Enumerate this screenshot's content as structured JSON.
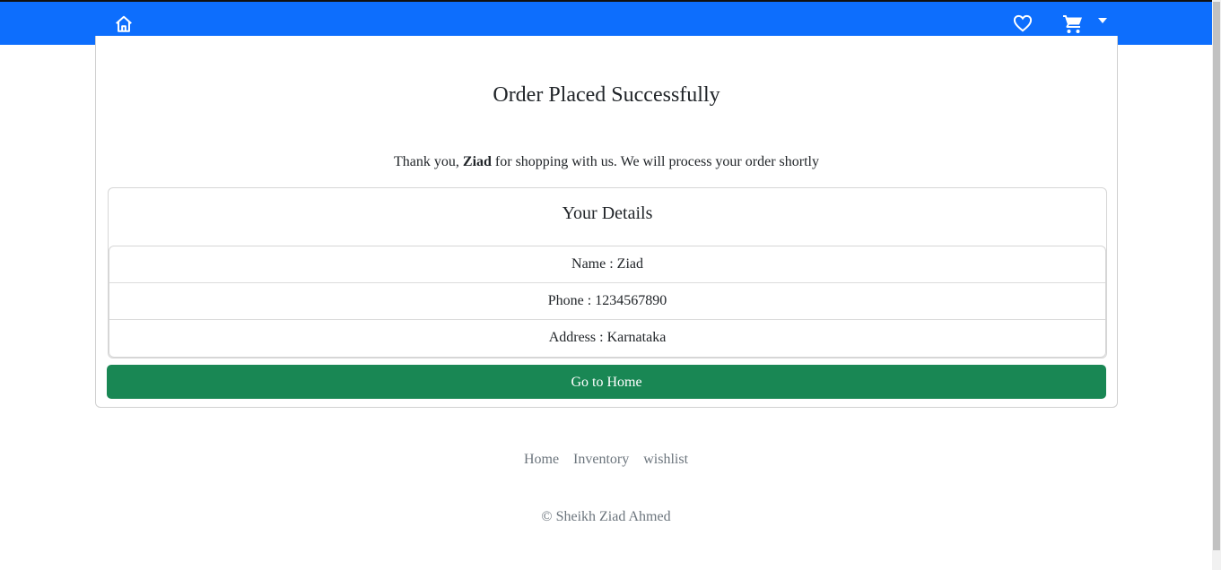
{
  "navbar": {
    "icons": [
      "home-icon",
      "heart-icon",
      "cart-icon",
      "caret-down-icon"
    ],
    "color": "#0d6efd"
  },
  "order": {
    "title": "Order Placed Successfully",
    "thanks_prefix": "Thank you, ",
    "customer_name": "Ziad",
    "thanks_suffix": " for shopping with us. We will process your order shortly"
  },
  "details": {
    "title": "Your Details",
    "items": [
      "Name : Ziad",
      "Phone : 1234567890",
      "Address : Karnataka"
    ]
  },
  "actions": {
    "home_button": "Go to Home",
    "button_color": "#198754"
  },
  "footer": {
    "links": [
      "Home",
      "Inventory",
      "wishlist"
    ],
    "copyright": "© Sheikh Ziad Ahmed"
  }
}
